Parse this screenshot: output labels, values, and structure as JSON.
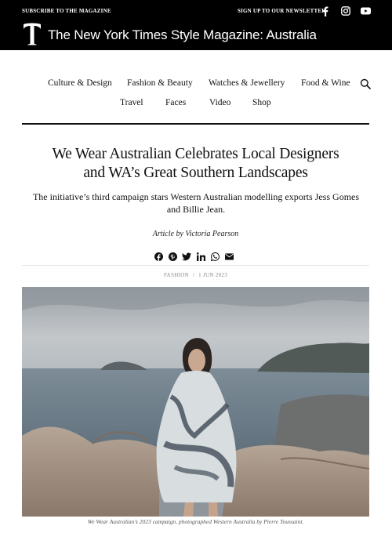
{
  "header": {
    "subscribe_label": "SUBSCRIBE TO THE MAGAZINE",
    "newsletter_label": "SIGN UP TO OUR NEWSLETTER",
    "logo_letter": "T",
    "site_title": "The New York Times Style Magazine: Australia",
    "social": [
      "facebook-icon",
      "instagram-icon",
      "youtube-icon"
    ]
  },
  "nav": {
    "row1": [
      "Culture & Design",
      "Fashion & Beauty",
      "Watches & Jewellery",
      "Food & Wine"
    ],
    "row2": [
      "Travel",
      "Faces",
      "Video",
      "Shop"
    ],
    "search_icon": "search-icon"
  },
  "article": {
    "headline_line1": "We Wear Australian Celebrates Local Designers",
    "headline_line2": "and WA’s Great Southern Landscapes",
    "standfirst": "The initiative’s third campaign stars Western Australian modelling exports Jess Gomes and Billie Jean.",
    "byline_prefix": "Article by",
    "author": "Victoria Pearson",
    "share_icons": [
      "facebook-icon",
      "pinterest-icon",
      "twitter-icon",
      "linkedin-icon",
      "whatsapp-icon",
      "email-icon"
    ],
    "category": "FASHION",
    "separator": "/",
    "date": "1 JUN 2023",
    "caption": "We Wear Australian’s 2023 campaign, photographed Western Australia by Pierre Toussaint."
  },
  "colors": {
    "header_bg": "#000000",
    "header_text": "#ffffff",
    "meta_text": "#888888"
  }
}
